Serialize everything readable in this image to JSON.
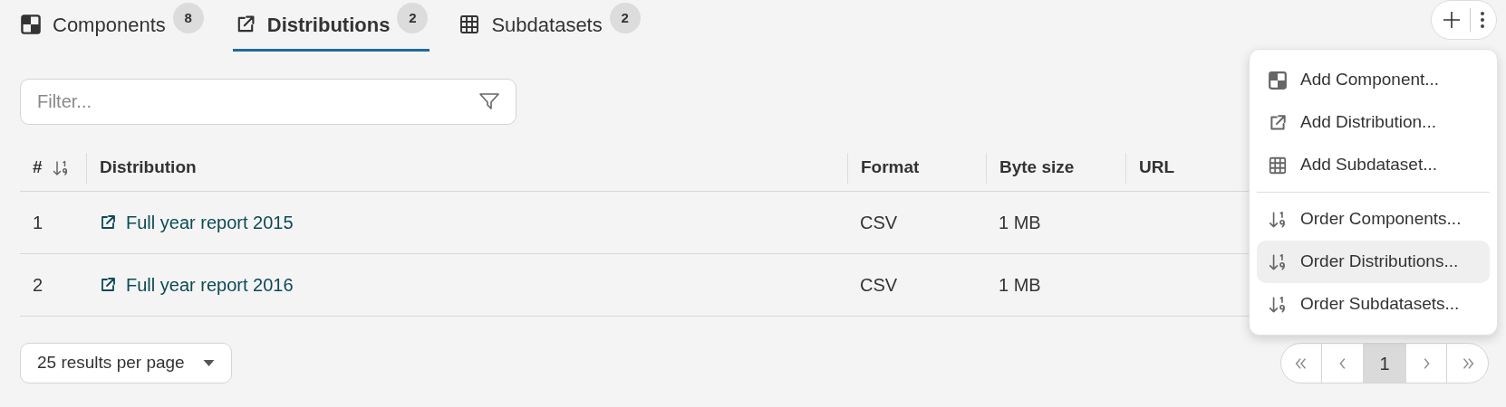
{
  "tabs": [
    {
      "kind": "component",
      "label": "Components",
      "count": "8",
      "selected": false
    },
    {
      "kind": "distribution",
      "label": "Distributions",
      "count": "2",
      "selected": true
    },
    {
      "kind": "subdataset",
      "label": "Subdatasets",
      "count": "2",
      "selected": false
    }
  ],
  "menu": {
    "groups": [
      [
        {
          "kind": "component",
          "label": "Add Component...",
          "highlighted": false
        },
        {
          "kind": "distribution",
          "label": "Add Distribution...",
          "highlighted": false
        },
        {
          "kind": "subdataset",
          "label": "Add Subdataset...",
          "highlighted": false
        }
      ],
      [
        {
          "kind": "order",
          "label": "Order Components...",
          "highlighted": false
        },
        {
          "kind": "order",
          "label": "Order Distributions...",
          "highlighted": true
        },
        {
          "kind": "order",
          "label": "Order Subdatasets...",
          "highlighted": false
        }
      ]
    ]
  },
  "filter": {
    "placeholder": "Filter..."
  },
  "table": {
    "columns": [
      "#",
      "Distribution",
      "Format",
      "Byte size",
      "URL"
    ],
    "rows": [
      {
        "number": "1",
        "name": "Full year report 2015",
        "format": "CSV",
        "byte_size": "1 MB"
      },
      {
        "number": "2",
        "name": "Full year report 2016",
        "format": "CSV",
        "byte_size": "1 MB"
      }
    ]
  },
  "per_page": "25 results per page",
  "pagination": {
    "pages": [
      {
        "label": "1",
        "selected": true
      }
    ]
  }
}
